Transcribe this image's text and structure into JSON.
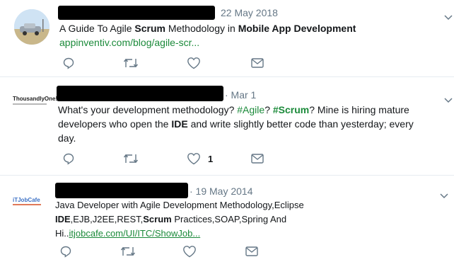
{
  "tweets": [
    {
      "date": "22 May 2018",
      "line1": {
        "a": "A Guide To Agile ",
        "b": "Scrum",
        "c": " Methodology in ",
        "d": "Mobile App Development"
      },
      "link": "appinventiv.com/blog/agile-scr...",
      "like_count": ""
    },
    {
      "avatar_text": "ThousandlyOne!",
      "date": "· Mar 1",
      "line1": {
        "a": "What's your development methodology? ",
        "h1": "#Agile",
        "b": "? ",
        "h2": "#Scrum",
        "c": "? Mine is hiring mature"
      },
      "line2": {
        "a": "developers who open the ",
        "b": "IDE",
        "c": " and write slightly better code than yesterday; every"
      },
      "line3": "day.",
      "like_count": "1"
    },
    {
      "avatar_text": "iTJobCafe",
      "date": "· 19 May 2014",
      "line1": "Java Developer with Agile Development Methodology,Eclipse",
      "line2": {
        "a": "IDE",
        "b": ",EJB,J2EE,REST,",
        "c": "Scrum",
        "d": " Practices,SOAP,Spring And"
      },
      "line3": {
        "a": "Hi..",
        "link": "itjobcafe.com/UI/ITC/ShowJob..."
      },
      "like_count": ""
    }
  ],
  "icons": [
    "reply-icon",
    "retweet-icon",
    "like-icon",
    "message-icon",
    "caret-down-icon"
  ]
}
